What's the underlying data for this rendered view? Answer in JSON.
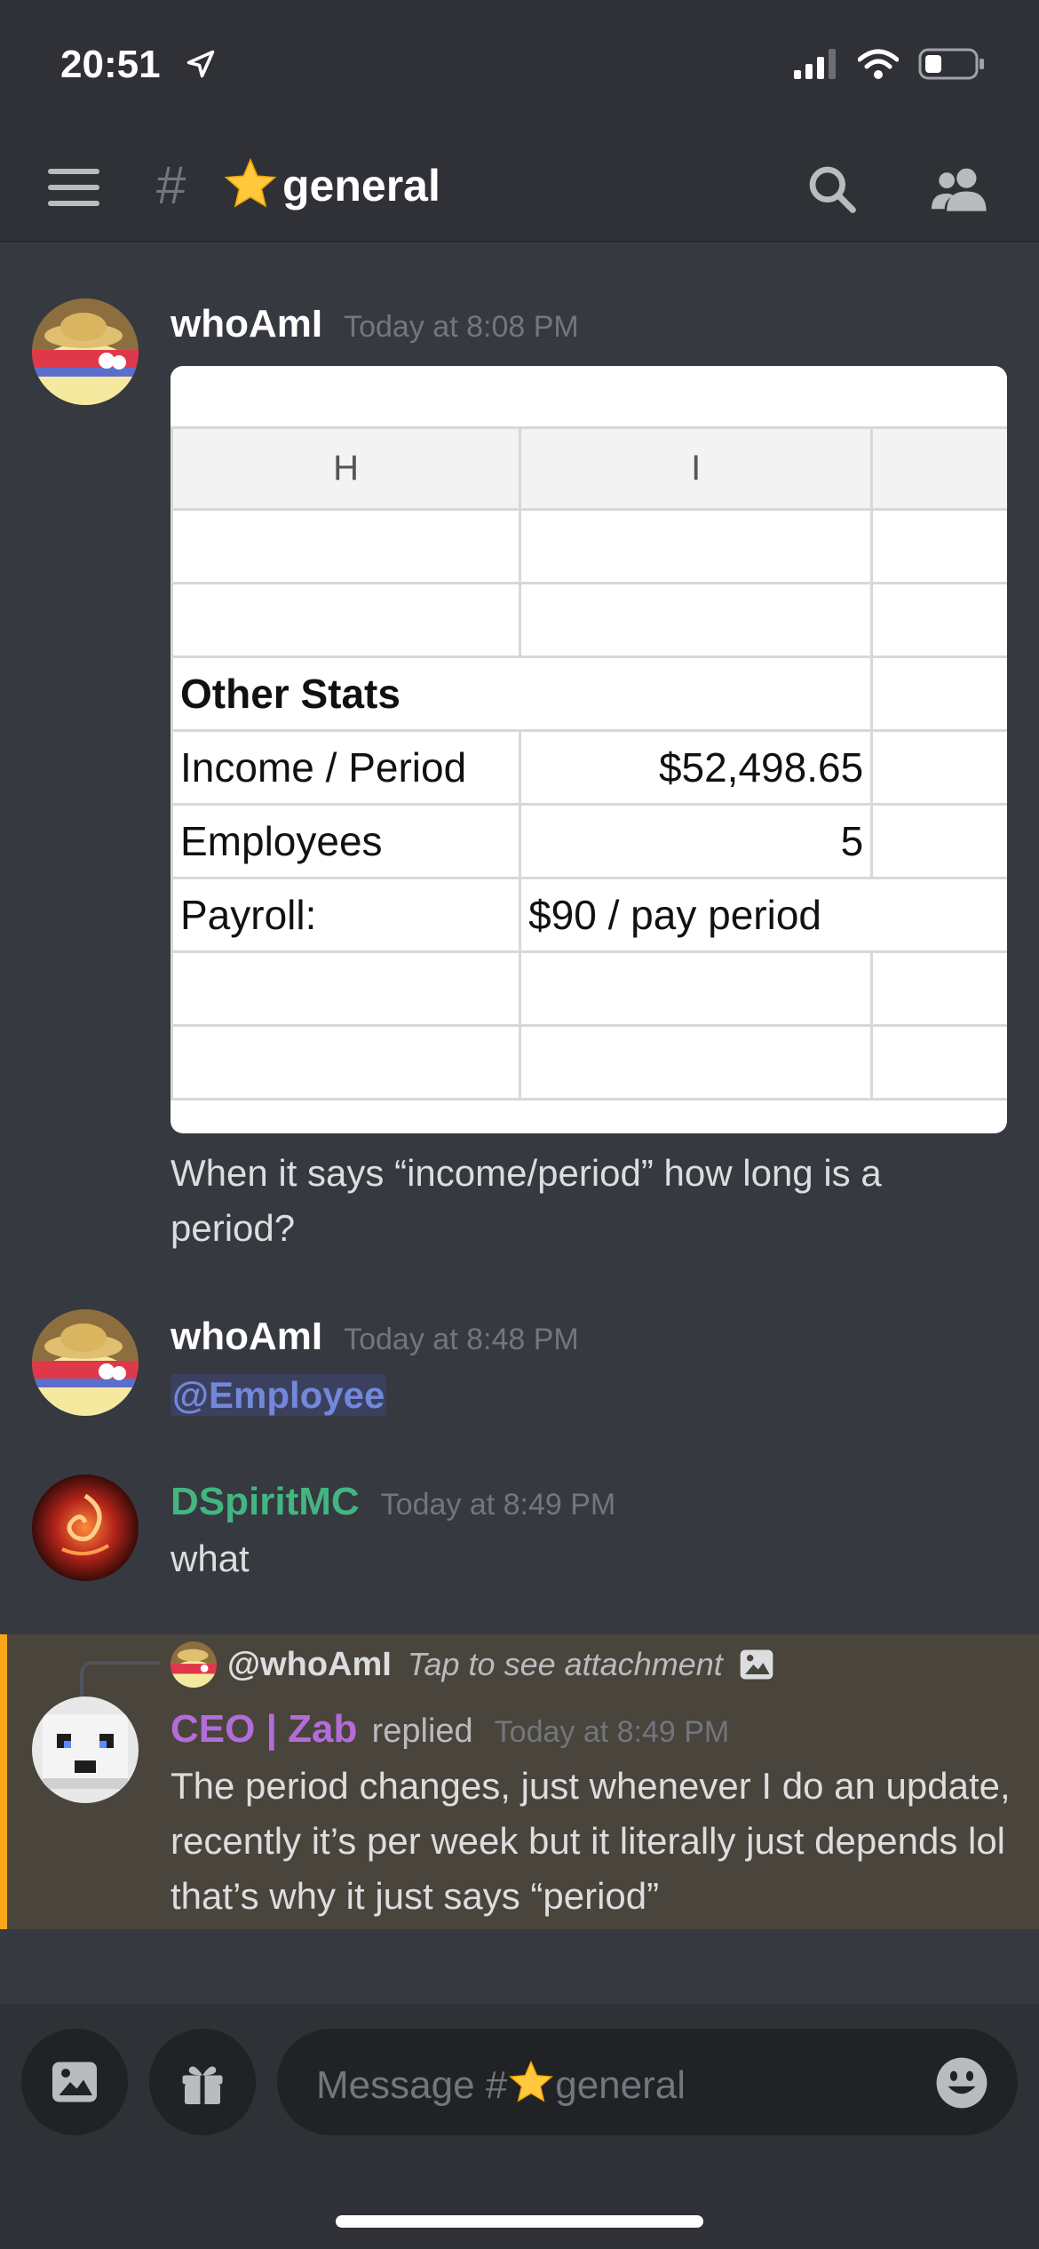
{
  "status_bar": {
    "time": "20:51"
  },
  "channel": {
    "hash": "#",
    "name": "general",
    "emoji": "star"
  },
  "messages": [
    {
      "author": "whoAmI",
      "timestamp": "Today at 8:08 PM",
      "attachment": {
        "columns": [
          "H",
          "I",
          ""
        ],
        "rows": [
          [
            "",
            "",
            ""
          ],
          [
            "",
            "",
            ""
          ],
          [
            "Other Stats",
            "",
            ""
          ],
          [
            "Income / Period",
            "$52,498.65",
            ""
          ],
          [
            "Employees",
            "5",
            ""
          ],
          [
            "Payroll:",
            "$90 / pay period",
            ""
          ],
          [
            "",
            "",
            ""
          ],
          [
            "",
            "",
            ""
          ]
        ]
      },
      "text": "When it says “income/period” how long is a period?"
    },
    {
      "author": "whoAmI",
      "timestamp": "Today at 8:48 PM",
      "mention": "@Employee"
    },
    {
      "author": "DSpiritMC",
      "timestamp": "Today at 8:49 PM",
      "text": "what",
      "author_color": "#43b581"
    },
    {
      "reply_to": "@whoAmI",
      "reply_preview": "Tap to see attachment",
      "author": "CEO | Zab",
      "replied_label": "replied",
      "timestamp": "Today at 8:49 PM",
      "text": "The period changes, just whenever I do an update, recently it’s per week but it literally just depends lol that’s why it just says “period”",
      "author_color": "#b46cd9"
    }
  ],
  "composer": {
    "placeholder_prefix": "Message #",
    "placeholder_channel": "general"
  },
  "colors": {
    "background": "#36393f",
    "header": "#2f3136",
    "highlight": "#49443c",
    "highlight_bar": "#faa61a",
    "mention": "#7289da"
  }
}
